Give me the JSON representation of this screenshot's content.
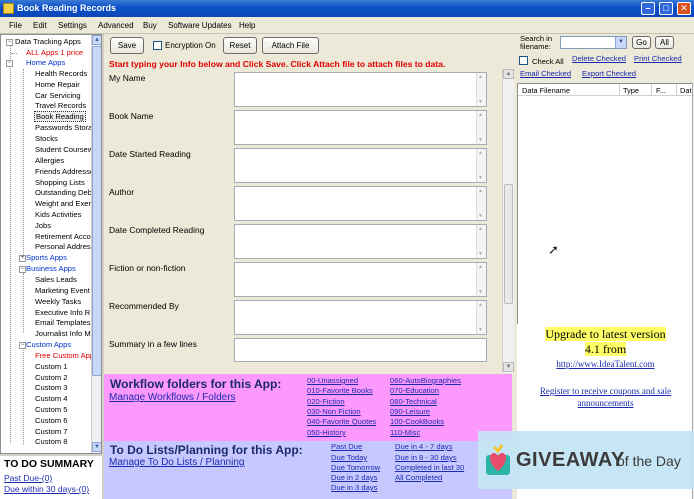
{
  "window": {
    "title": "Book Reading Records"
  },
  "menu": [
    "File",
    "Edit",
    "Settings",
    "Advanced",
    "Buy",
    "Software Updates",
    "Help"
  ],
  "tree": {
    "items": [
      {
        "label": "Data Tracking Apps",
        "color": "black"
      },
      {
        "label": "ALL Apps 1 price",
        "color": "red"
      },
      {
        "label": "Home Apps",
        "color": "blue"
      },
      {
        "label": "Health Records"
      },
      {
        "label": "Home Repair"
      },
      {
        "label": "Car Servicing"
      },
      {
        "label": "Travel Records"
      },
      {
        "label": "Book Reading",
        "selected": true
      },
      {
        "label": "Passwords Stora"
      },
      {
        "label": "Stocks"
      },
      {
        "label": "Student Coursew"
      },
      {
        "label": "Allergies"
      },
      {
        "label": "Friends Addresse"
      },
      {
        "label": "Shopping Lists"
      },
      {
        "label": "Outstanding Deb"
      },
      {
        "label": "Weight and Exer"
      },
      {
        "label": "Kids Activities"
      },
      {
        "label": "Jobs"
      },
      {
        "label": "Retirement Acco"
      },
      {
        "label": "Personal Addres"
      },
      {
        "label": "Sports Apps",
        "color": "blue"
      },
      {
        "label": "Business Apps",
        "color": "blue"
      },
      {
        "label": "Sales Leads"
      },
      {
        "label": "Marketing Event"
      },
      {
        "label": "Weekly Tasks"
      },
      {
        "label": "Executive Info R"
      },
      {
        "label": "Email Templates"
      },
      {
        "label": "Journalist Info M"
      },
      {
        "label": "Custom Apps",
        "color": "blue"
      },
      {
        "label": "Free Custom App",
        "color": "red"
      },
      {
        "label": "Custom 1"
      },
      {
        "label": "Custom 2"
      },
      {
        "label": "Custom 3"
      },
      {
        "label": "Custom 4"
      },
      {
        "label": "Custom 5"
      },
      {
        "label": "Custom 6"
      },
      {
        "label": "Custom 7"
      },
      {
        "label": "Custom 8"
      }
    ]
  },
  "todo_summary": {
    "title": "TO DO SUMMARY",
    "past_due": "Past Due-(0)",
    "due_30": "Due within 30 days-(0)"
  },
  "toolbar": {
    "save": "Save",
    "encryption": "Encryption On",
    "reset": "Reset",
    "attach": "Attach File"
  },
  "instruction": "Start typing your Info below and Click Save. Click Attach file to attach files to data.",
  "fields": [
    "My Name",
    "Book Name",
    "Date Started Reading",
    "Author",
    "Date Completed Reading",
    "Fiction or non-fiction",
    "Recommended By",
    "Summary in a few lines"
  ],
  "workflow": {
    "title": "Workflow folders for this App:",
    "manage": "Manage Workflows / Folders",
    "col1": [
      "00-Unassigned",
      "010-Favorite Books",
      "020-Fiction",
      "030-Non Fiction",
      "040-Favorite Quotes",
      "050-History"
    ],
    "col2": [
      "060-AutoBiographies",
      "070-Education",
      "080-Technical",
      "090-Leisure",
      "100-CookBooks",
      "110-Misc"
    ]
  },
  "todo_lists": {
    "title": "To Do Lists/Planning for this App:",
    "manage": "Manage To Do Lists / Planning",
    "col1": [
      "Past Due",
      "Due Today",
      "Due Tomorrow",
      "Due in 2 days",
      "Due in 3 days"
    ],
    "col2": [
      "Due in 4 - 7 days",
      "Due in 8 - 30 days",
      "Completed in last 30",
      "All Completed"
    ]
  },
  "search": {
    "label": "Search in filename:",
    "go": "Go",
    "all": "All",
    "check_all": "Check All",
    "delete_checked": "Delete Checked",
    "print_checked": "Print Checked",
    "email_checked": "Email Checked",
    "export_checked": "Export Checked"
  },
  "filelist": {
    "columns": [
      "Data Filename",
      "Type",
      "F...",
      "Dat"
    ]
  },
  "upgrade": {
    "line1": "Upgrade to latest version",
    "line2": "4.1 from",
    "url": "http://www.IdeaTalent.com",
    "register": "Register to receive coupons and sale announcements"
  },
  "watermark": {
    "brand": "GIVEAWAY",
    "suffix": "of the Day"
  },
  "colors": {
    "workflow_bg": "#fd99fd",
    "todo_bg": "#c7c8ff",
    "instruction": "#e00000",
    "upgrade_highlight": "#ffff66"
  }
}
